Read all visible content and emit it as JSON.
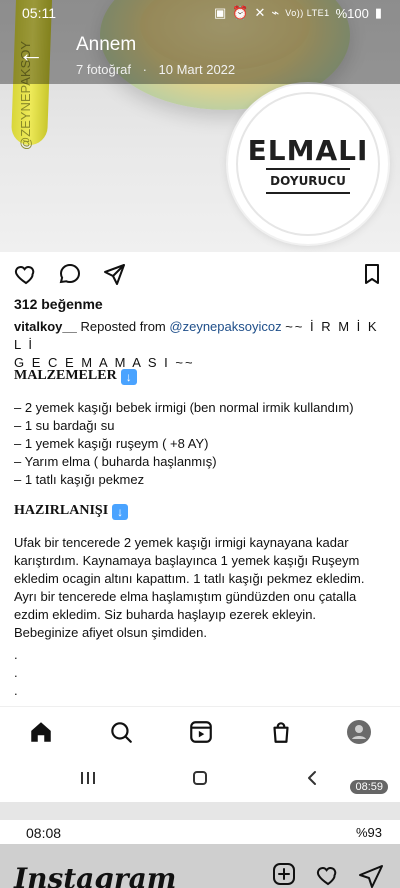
{
  "status_bar": {
    "time": "05:11",
    "right_text": "%100",
    "network": "Vo)) LTE1"
  },
  "header": {
    "title": "Annem",
    "meta_left": "7 fotoğraf",
    "meta_sep": "·",
    "meta_right": "10 Mart 2022"
  },
  "photo": {
    "spoon_text": "@ZEYNEPAKSOY",
    "badge_title": "ELMALI",
    "badge_sub": "DOYURUCU"
  },
  "post": {
    "likes": "312 beğenme",
    "caption_user": "vitalkoy__",
    "caption_reposted": "Reposted from",
    "caption_mention": "@zeynepaksoyicoz",
    "caption_tail_1": "~~ İ R M İ K L İ",
    "caption_tail_2": "G E C E M A M A S I ~~"
  },
  "content": {
    "malzemeler_title": "MALZEMELER",
    "ingredients": [
      "– 2 yemek kaşığı bebek irmigi (ben normal irmik kullandım)",
      "– 1 su bardağı su",
      "– 1 yemek kaşığı ruşeym ( +8 AY)",
      "– Yarım elma ( buharda haşlanmış)",
      "– 1 tatlı kaşığı pekmez"
    ],
    "hazirlanisi_title": "HAZIRLANIŞI",
    "prep_lines": [
      "Ufak bir tencerede 2 yemek kaşığı irmigi kaynayana kadar",
      "karıştırdım. Kaynamaya başlayınca 1 yemek kaşığı Ruşeym",
      "ekledim ocagin altını kapattım. 1 tatlı kaşığı pekmez ekledim.",
      "Ayrı bir tencerede elma haşlamıştım gündüzden onu çatalla",
      "ezdim ekledim. Siz buharda haşlayıp ezerek ekleyin.",
      "Bebeginize afiyet olsun şimdiden."
    ],
    "dots": [
      ".",
      ".",
      "."
    ]
  },
  "system_nav": {
    "timer": "08:59"
  },
  "lower_strip": {
    "status_time": "08:08",
    "status_right": "%93",
    "brand": "Instagram"
  },
  "colors": {
    "link": "#1f4f8a",
    "info_blue": "#4aa3ff"
  }
}
